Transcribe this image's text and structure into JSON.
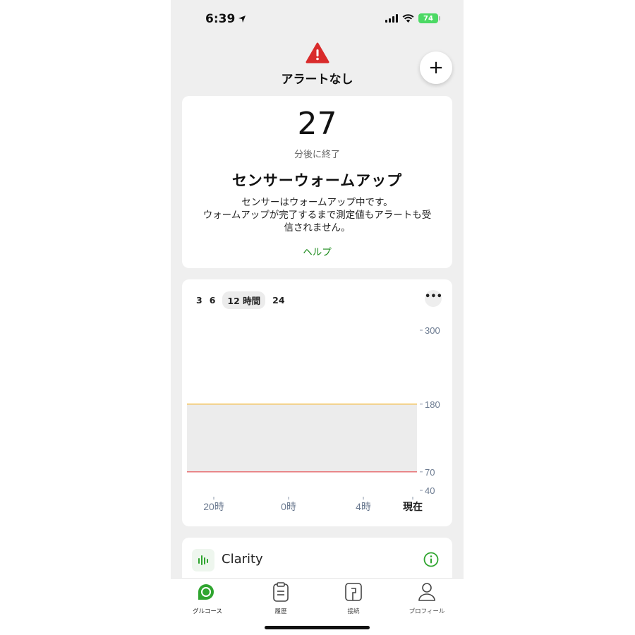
{
  "status_bar": {
    "time": "6:39",
    "battery": "74"
  },
  "header": {
    "alert_title": "アラートなし",
    "add_symbol": "+"
  },
  "warmup": {
    "minutes": "27",
    "minutes_sub": "分後に終了",
    "title": "センサーウォームアップ",
    "desc_line1": "センサーはウォームアップ中です。",
    "desc_line2": "ウォームアップが完了するまで測定値もアラートも受",
    "desc_line3": "信されません。",
    "help": "ヘルプ"
  },
  "chart": {
    "ranges": [
      "3",
      "6",
      "12 時間",
      "24"
    ],
    "active_range": "12 時間",
    "more": "•••"
  },
  "chart_data": {
    "type": "line",
    "y_ticks": [
      300,
      180,
      70,
      40
    ],
    "x_ticks": [
      "20時",
      "0時",
      "4時",
      "現在"
    ],
    "ylim": [
      40,
      300
    ],
    "target_range": [
      70,
      180
    ],
    "high_threshold": 180,
    "low_threshold": 70,
    "series": [],
    "colors": {
      "high": "#f5b731",
      "low": "#e5484d",
      "band": "#ececec"
    }
  },
  "clarity": {
    "label": "Clarity"
  },
  "tabs": [
    {
      "label": "グルコース",
      "icon": "glucose-icon",
      "active": true
    },
    {
      "label": "履歴",
      "icon": "history-icon",
      "active": false
    },
    {
      "label": "接続",
      "icon": "connection-icon",
      "active": false
    },
    {
      "label": "プロフィール",
      "icon": "profile-icon",
      "active": false
    }
  ],
  "colors": {
    "accent": "#2fa52f",
    "alert": "#d92b2b"
  }
}
